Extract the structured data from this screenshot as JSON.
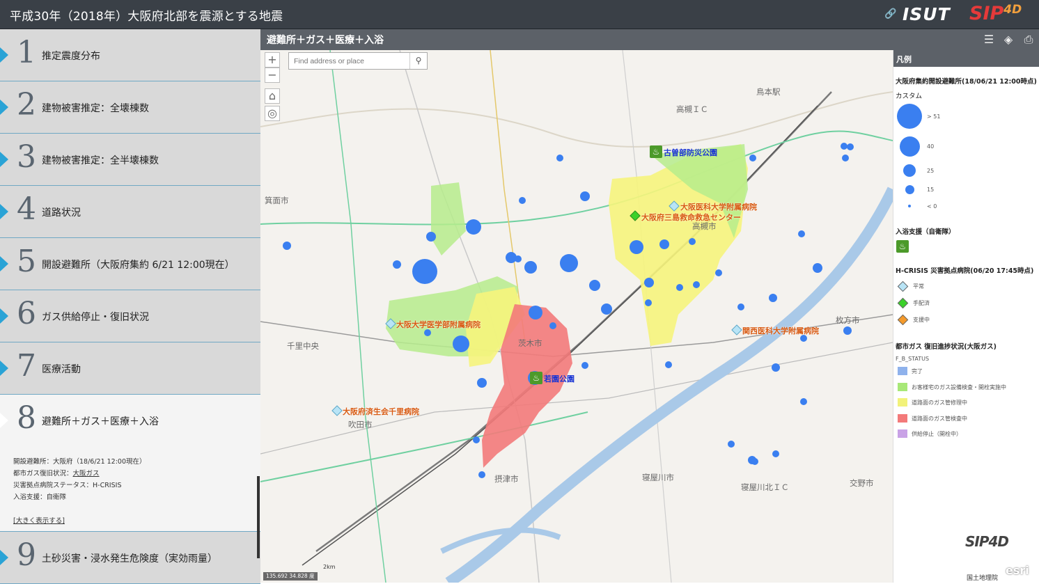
{
  "header": {
    "title": "平成30年（2018年）大阪府北部を震源とする地震",
    "logo1": "ISUT",
    "logo2": "SIP",
    "logo2_sup": "4D"
  },
  "sidebar": {
    "items": [
      {
        "num": "1",
        "label": "推定震度分布"
      },
      {
        "num": "2",
        "label": "建物被害推定：全壊棟数"
      },
      {
        "num": "3",
        "label": "建物被害推定：全半壊棟数"
      },
      {
        "num": "4",
        "label": "道路状況"
      },
      {
        "num": "5",
        "label": "開設避難所（大阪府集約 6/21 12:00現在）"
      },
      {
        "num": "6",
        "label": "ガス供給停止・復旧状況"
      },
      {
        "num": "7",
        "label": "医療活動"
      },
      {
        "num": "8",
        "label": "避難所＋ガス＋医療＋入浴"
      },
      {
        "num": "9",
        "label": "土砂災害・浸水発生危険度（実効雨量）"
      }
    ],
    "details": {
      "line1": "開設避難所：大阪府（18/6/21 12:00現在）",
      "line2_prefix": "都市ガス復旧状況：",
      "line2_link": "大阪ガス",
      "line3": "災害拠点病院ステータス：H-CRISIS",
      "line4": "入浴支援：自衛隊",
      "enlarge": "[大きく表示する]"
    }
  },
  "map": {
    "title": "避難所＋ガス＋医療＋入浴",
    "search_placeholder": "Find address or place",
    "scale": "2km",
    "coords": "135.692 34.828 度",
    "labels": {
      "park1": "古曽部防災公園",
      "park2": "若園公園",
      "hosp1": "大阪医科大学附属病院",
      "hosp2": "大阪府三島救命救急センター",
      "hosp3": "大阪大学医学部附属病院",
      "hosp4": "関西医科大学附属病院",
      "hosp5": "大阪府済生会千里病院"
    },
    "towns": {
      "t1": "茨木市",
      "t2": "高槻市",
      "t3": "吹田市",
      "t4": "摂津市",
      "t5": "寝屋川市",
      "t6": "枚方市",
      "t7": "交野市",
      "t8": "箕面市",
      "t9": "鳥本駅",
      "t10": "高槻ＩＣ",
      "t11": "千里中央",
      "t12": "寝屋川北ＩＣ"
    }
  },
  "legend": {
    "title": "凡例",
    "shelter_title": "大阪府集約開設避難所(18/06/21 12:00時点)",
    "custom": "カスタム",
    "sizes": [
      "> 51",
      "40",
      "25",
      "15",
      "< 0"
    ],
    "bath_title": "入浴支援（自衛隊）",
    "hcrisis_title": "H-CRISIS 災害拠点病院(06/20 17:45時点)",
    "hcrisis_items": [
      "平常",
      "手配済",
      "支援中"
    ],
    "gas_title": "都市ガス 復旧進捗状況(大阪ガス)",
    "gas_field": "F_B_STATUS",
    "gas_items": [
      "完了",
      "お客様宅のガス設備検査・開栓実施中",
      "道路面のガス管修理中",
      "道路面のガス管検査中",
      "供給停止（開栓中）"
    ],
    "colors": {
      "shelter": "#3a7ff0",
      "normal": "#b8e4f6",
      "arranged": "#3bd12a",
      "support": "#f59a2a",
      "gas": [
        "#8fb2ec",
        "#a8e878",
        "#f2f27a",
        "#f37a7a",
        "#c9a2e6"
      ]
    }
  },
  "footer": {
    "esri": "esri",
    "gsi": "国土地理院",
    "sip": "SIP",
    "sip_sup": "4D"
  }
}
